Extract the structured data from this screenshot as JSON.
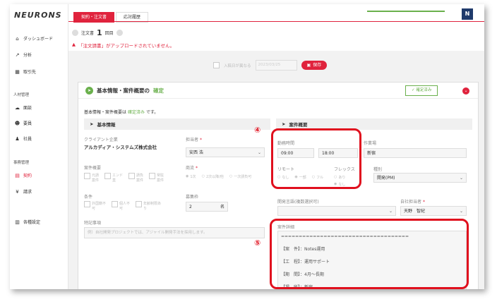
{
  "app": {
    "logo": "NEURONS"
  },
  "sidebar": {
    "items": [
      {
        "icon": "home-icon",
        "glyph": "⌂",
        "label": "ダッシュボード"
      },
      {
        "icon": "chart-icon",
        "glyph": "↗",
        "label": "分析"
      },
      {
        "icon": "building-icon",
        "glyph": "▦",
        "label": "取引先"
      }
    ],
    "section_hr": "人材管理",
    "hr_items": [
      {
        "icon": "chat-icon",
        "glyph": "☁",
        "label": "面談"
      },
      {
        "icon": "users-icon",
        "glyph": "☻",
        "label": "要員"
      },
      {
        "icon": "user-icon",
        "glyph": "♟",
        "label": "社員"
      }
    ],
    "section_biz": "事務管理",
    "biz_items": [
      {
        "icon": "contract-icon",
        "glyph": "▤",
        "label": "契約",
        "active": true
      },
      {
        "icon": "yen-icon",
        "glyph": "¥",
        "label": "請求"
      }
    ],
    "settings": {
      "icon": "book-icon",
      "glyph": "▥",
      "label": "各種設定"
    }
  },
  "tabs": [
    {
      "label": "契約・注文書",
      "active": true
    },
    {
      "label": "応対履歴",
      "active": false
    }
  ],
  "order": {
    "label": "注文書",
    "number": "1",
    "suffix": "回目"
  },
  "alert": {
    "icon": "warning-icon",
    "text": "「注文請書」がアップロードされていません。"
  },
  "date_row": {
    "checkbox_label": "入稿日が異なる",
    "date_value": "2023/03/25",
    "save_label": "保存"
  },
  "card": {
    "title": "基本情報・案件概要の",
    "title_status": "確定",
    "confirmed_button": "確定済み",
    "status_prefix": "基本情報・案件概要は",
    "status_value": "確定済み",
    "status_suffix": "です。"
  },
  "basic": {
    "heading": "基本情報",
    "client_label": "クライアント企業",
    "client_value": "アルカディア・システムズ株式会社",
    "owner_label": "担当者",
    "owner_value": "安西 浩",
    "summary_label": "案件概要",
    "summary_options": [
      "元請\n案件",
      "エンド\n直",
      "請負\n案件",
      "常駐\n案件"
    ],
    "commerce_label": "商流",
    "commerce_options": [
      "1次",
      "2次以降/他",
      "一次請負可"
    ],
    "conditions_label": "条件",
    "conditions_options": [
      "外国籍不\n可",
      "個人不\n可",
      "年齢制限あ\nり"
    ],
    "recruit_label": "募集枠",
    "recruit_value": "2",
    "recruit_unit": "名",
    "notes_label": "特記事項",
    "notes_placeholder": "例）自社開発プロジェクトでは、アジャイル開発手法を採用します。"
  },
  "overview": {
    "heading": "案件概要",
    "hours_label": "勤務時間",
    "hours_start": "09:00",
    "hours_end": "18:00",
    "location_label": "作業場",
    "location_value": "新宿",
    "remote_label": "リモート",
    "remote_options": [
      "なし",
      "一部",
      "フル"
    ],
    "flex_label": "フレックス",
    "flex_options": [
      "あり",
      "なし"
    ],
    "type_label": "種別",
    "type_value": "開発(PM)",
    "lang_label": "開発言語(複数選択可)",
    "staff_label": "自社担当者",
    "staff_value": "天野　智紀",
    "detail_label": "案件詳細",
    "detail_lines": [
      "====================================",
      "【案　件】：Notes運用",
      "【工　程】：運用サポート",
      "【期　間】：4月～長期",
      "【場　所】：新宿"
    ]
  },
  "annotations": {
    "circle4": "④",
    "circle5": "⑤"
  },
  "colors": {
    "brand": "#e0233d",
    "accent_green": "#6ab04c",
    "annotation_red": "#e0101e"
  }
}
